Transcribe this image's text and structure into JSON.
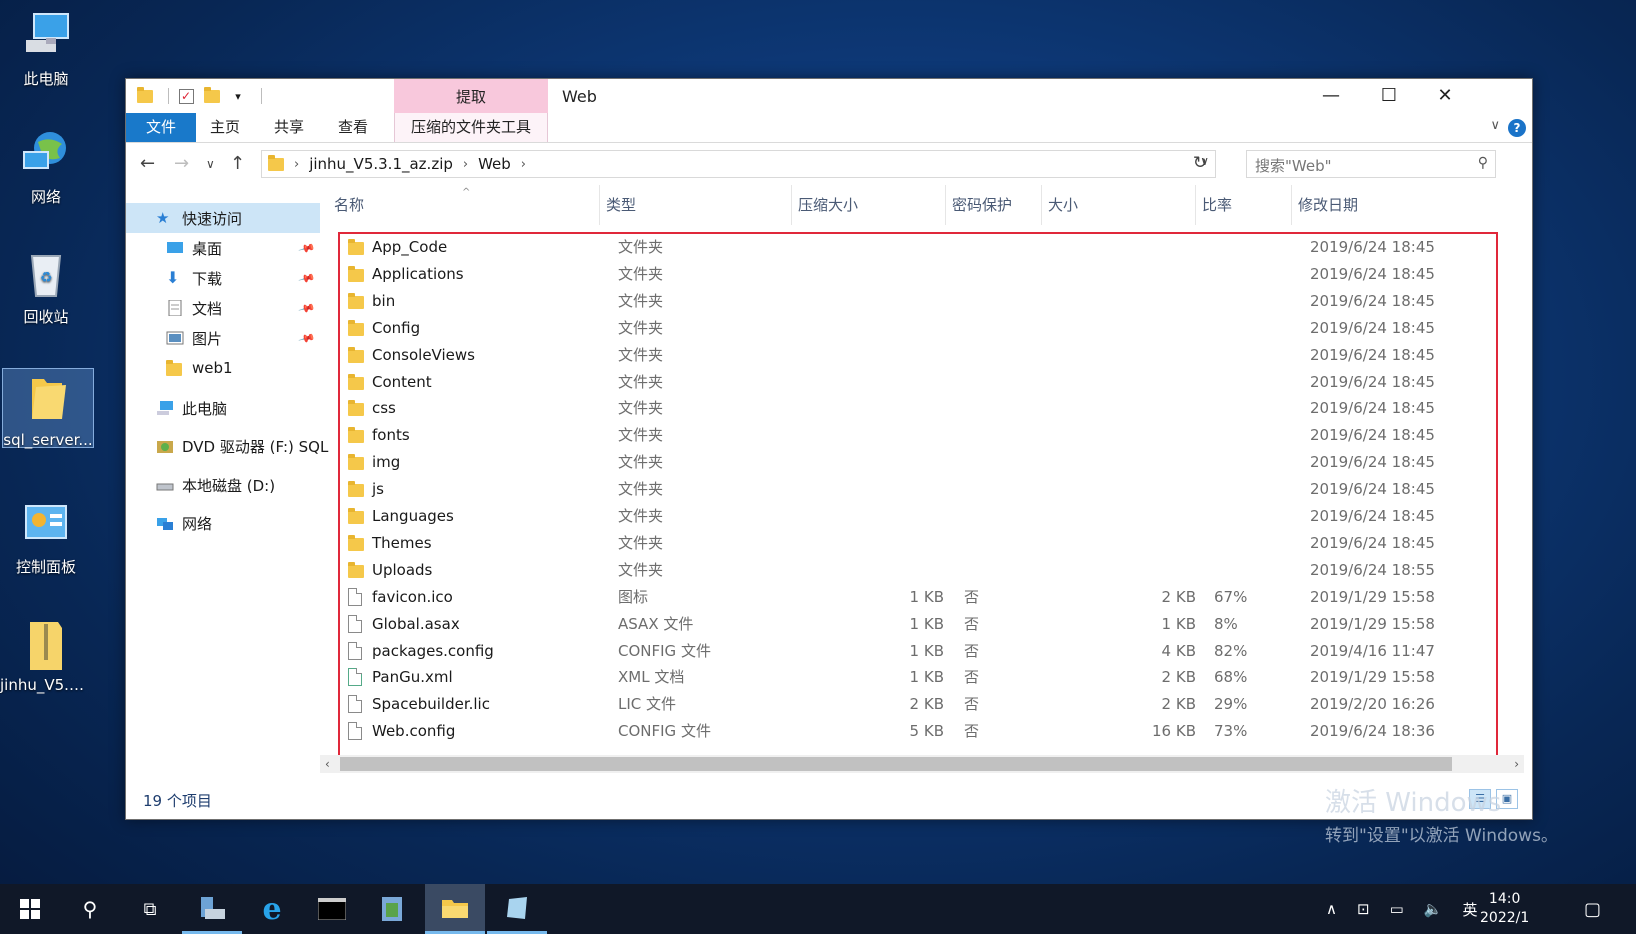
{
  "desktop": {
    "icons": [
      {
        "label": "此电脑"
      },
      {
        "label": "网络"
      },
      {
        "label": "回收站"
      },
      {
        "label": "sql_server..."
      },
      {
        "label": "控制面板"
      },
      {
        "label": "jinhu_V5.3..."
      }
    ]
  },
  "window": {
    "title": "Web",
    "context_tab_group": "提取",
    "ribbon_tabs": [
      "文件",
      "主页",
      "共享",
      "查看",
      "压缩的文件夹工具"
    ],
    "controls": {
      "minimize": "—",
      "maximize": "☐",
      "close": "✕"
    },
    "help": "?"
  },
  "address": {
    "crumbs": [
      "jinhu_V5.3.1_az.zip",
      "Web"
    ],
    "search_placeholder": "搜索\"Web\""
  },
  "nav": {
    "quick_access": "快速访问",
    "pinned": [
      "桌面",
      "下载",
      "文档",
      "图片"
    ],
    "recent": "web1",
    "this_pc": "此电脑",
    "dvd": "DVD 驱动器 (F:) SQL",
    "local_disk": "本地磁盘 (D:)",
    "network": "网络"
  },
  "columns": [
    "名称",
    "类型",
    "压缩大小",
    "密码保护",
    "大小",
    "比率",
    "修改日期"
  ],
  "files": [
    {
      "name": "App_Code",
      "type": "文件夹",
      "csize": "",
      "pw": "",
      "size": "",
      "ratio": "",
      "date": "2019/6/24 18:45",
      "icon": "folder"
    },
    {
      "name": "Applications",
      "type": "文件夹",
      "csize": "",
      "pw": "",
      "size": "",
      "ratio": "",
      "date": "2019/6/24 18:45",
      "icon": "folder"
    },
    {
      "name": "bin",
      "type": "文件夹",
      "csize": "",
      "pw": "",
      "size": "",
      "ratio": "",
      "date": "2019/6/24 18:45",
      "icon": "folder"
    },
    {
      "name": "Config",
      "type": "文件夹",
      "csize": "",
      "pw": "",
      "size": "",
      "ratio": "",
      "date": "2019/6/24 18:45",
      "icon": "folder"
    },
    {
      "name": "ConsoleViews",
      "type": "文件夹",
      "csize": "",
      "pw": "",
      "size": "",
      "ratio": "",
      "date": "2019/6/24 18:45",
      "icon": "folder"
    },
    {
      "name": "Content",
      "type": "文件夹",
      "csize": "",
      "pw": "",
      "size": "",
      "ratio": "",
      "date": "2019/6/24 18:45",
      "icon": "folder"
    },
    {
      "name": "css",
      "type": "文件夹",
      "csize": "",
      "pw": "",
      "size": "",
      "ratio": "",
      "date": "2019/6/24 18:45",
      "icon": "folder"
    },
    {
      "name": "fonts",
      "type": "文件夹",
      "csize": "",
      "pw": "",
      "size": "",
      "ratio": "",
      "date": "2019/6/24 18:45",
      "icon": "folder"
    },
    {
      "name": "img",
      "type": "文件夹",
      "csize": "",
      "pw": "",
      "size": "",
      "ratio": "",
      "date": "2019/6/24 18:45",
      "icon": "folder"
    },
    {
      "name": "js",
      "type": "文件夹",
      "csize": "",
      "pw": "",
      "size": "",
      "ratio": "",
      "date": "2019/6/24 18:45",
      "icon": "folder"
    },
    {
      "name": "Languages",
      "type": "文件夹",
      "csize": "",
      "pw": "",
      "size": "",
      "ratio": "",
      "date": "2019/6/24 18:45",
      "icon": "folder"
    },
    {
      "name": "Themes",
      "type": "文件夹",
      "csize": "",
      "pw": "",
      "size": "",
      "ratio": "",
      "date": "2019/6/24 18:45",
      "icon": "folder"
    },
    {
      "name": "Uploads",
      "type": "文件夹",
      "csize": "",
      "pw": "",
      "size": "",
      "ratio": "",
      "date": "2019/6/24 18:55",
      "icon": "folder"
    },
    {
      "name": "favicon.ico",
      "type": "图标",
      "csize": "1 KB",
      "pw": "否",
      "size": "2 KB",
      "ratio": "67%",
      "date": "2019/1/29 15:58",
      "icon": "file"
    },
    {
      "name": "Global.asax",
      "type": "ASAX 文件",
      "csize": "1 KB",
      "pw": "否",
      "size": "1 KB",
      "ratio": "8%",
      "date": "2019/1/29 15:58",
      "icon": "file"
    },
    {
      "name": "packages.config",
      "type": "CONFIG 文件",
      "csize": "1 KB",
      "pw": "否",
      "size": "4 KB",
      "ratio": "82%",
      "date": "2019/4/16 11:47",
      "icon": "file"
    },
    {
      "name": "PanGu.xml",
      "type": "XML 文档",
      "csize": "1 KB",
      "pw": "否",
      "size": "2 KB",
      "ratio": "68%",
      "date": "2019/1/29 15:58",
      "icon": "xml"
    },
    {
      "name": "Spacebuilder.lic",
      "type": "LIC 文件",
      "csize": "2 KB",
      "pw": "否",
      "size": "2 KB",
      "ratio": "29%",
      "date": "2019/2/20 16:26",
      "icon": "file"
    },
    {
      "name": "Web.config",
      "type": "CONFIG 文件",
      "csize": "5 KB",
      "pw": "否",
      "size": "16 KB",
      "ratio": "73%",
      "date": "2019/6/24 18:36",
      "icon": "file"
    }
  ],
  "status": {
    "count": "19 个项目"
  },
  "watermark": {
    "line1": "激活 Windows",
    "line2": "转到\"设置\"以激活 Windows。"
  },
  "taskbar": {
    "ime": "英",
    "time": "14:0",
    "date": "2022/1"
  },
  "colors": {
    "accent": "#1979ca",
    "selection_frame": "#e0283a",
    "context_tab": "#f8c8dc"
  }
}
